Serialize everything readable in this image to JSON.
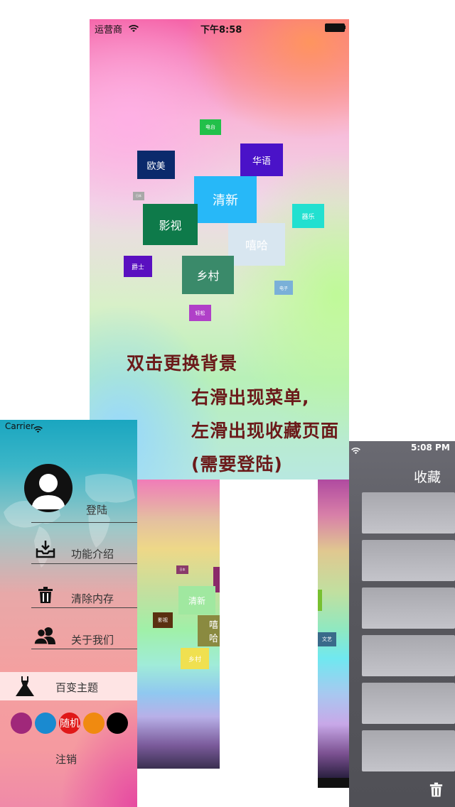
{
  "main": {
    "status": {
      "carrier": "运营商",
      "time": "下午8:58"
    },
    "tags": [
      {
        "label": "电台",
        "bg": "#22c04a"
      },
      {
        "label": "欧美",
        "bg": "#0b2a6c"
      },
      {
        "label": "华语",
        "bg": "#4a12c8"
      },
      {
        "label": "日本",
        "bg": "#a8a8a8"
      },
      {
        "label": "清新",
        "bg": "#27b8f8"
      },
      {
        "label": "影视",
        "bg": "#0e7a4a"
      },
      {
        "label": "器乐",
        "bg": "#22e0d0"
      },
      {
        "label": "嘻哈",
        "bg": "#d8e6f0"
      },
      {
        "label": "爵士",
        "bg": "#5a10c0"
      },
      {
        "label": "乡村",
        "bg": "#3a8a6a"
      },
      {
        "label": "电子",
        "bg": "#7ab0d8"
      },
      {
        "label": "轻松",
        "bg": "#b040c8"
      }
    ],
    "hints": {
      "line1": "双击更换背景",
      "line2": "右滑出现菜单,",
      "line3": "左滑出现收藏页面",
      "line4": "(需要登陆)"
    }
  },
  "menu": {
    "status": {
      "carrier": "Carrier"
    },
    "login": "登陆",
    "items": [
      {
        "label": "功能介绍",
        "icon": "inbox-download-icon"
      },
      {
        "label": "清除内存",
        "icon": "trash-icon"
      },
      {
        "label": "关于我们",
        "icon": "users-icon"
      }
    ],
    "theme": {
      "label": "百变主题",
      "icon": "dress-icon"
    },
    "colors": [
      {
        "color": "#a0287a",
        "label": ""
      },
      {
        "color": "#1a8ad0",
        "label": ""
      },
      {
        "color": "#e01818",
        "label": "随机"
      },
      {
        "color": "#f08a10",
        "label": ""
      },
      {
        "color": "#000000",
        "label": ""
      }
    ],
    "logout": "注销"
  },
  "preview": {
    "tags": [
      {
        "label": "日本",
        "bg": "#8a3a6a"
      },
      {
        "label": "清新",
        "bg": "#a0e8a0"
      },
      {
        "label": "影视",
        "bg": "#5a3010"
      },
      {
        "label": "嘻哈",
        "bg": "#8a8a40"
      },
      {
        "label": "乡村",
        "bg": "#f0e050"
      },
      {
        "label": "文艺",
        "bg": "#3a6a8a"
      }
    ]
  },
  "favorites": {
    "status": {
      "time": "5:08 PM"
    },
    "title": "收藏",
    "cards": 6,
    "delete_icon": "trash-icon"
  }
}
